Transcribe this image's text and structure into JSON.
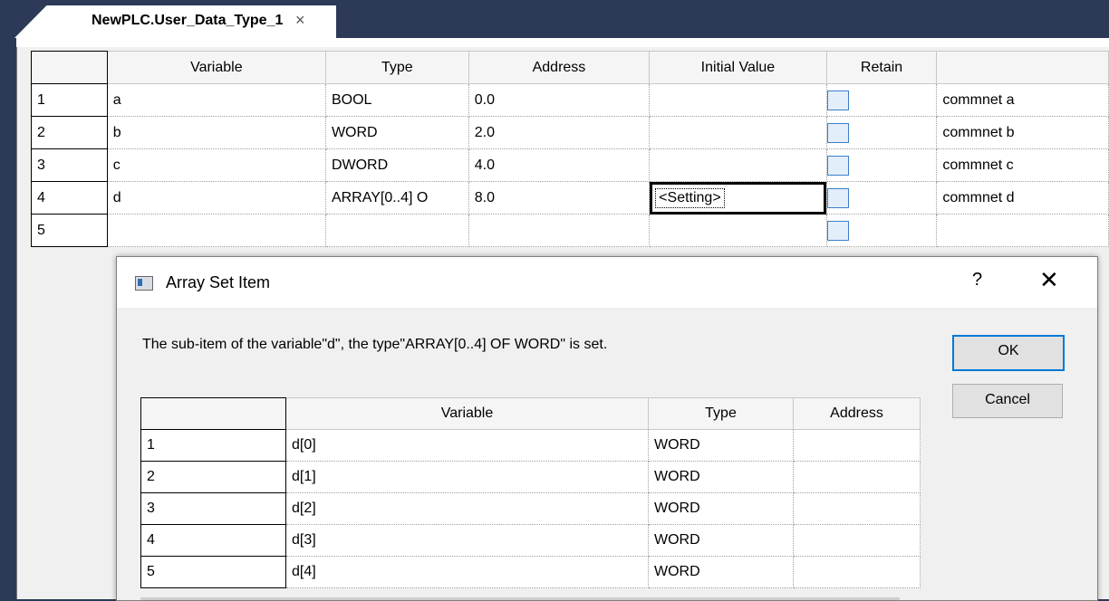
{
  "tab": {
    "title": "NewPLC.User_Data_Type_1",
    "close": "×"
  },
  "main_table": {
    "columns": [
      "",
      "Variable",
      "Type",
      "Address",
      "Initial Value",
      "Retain",
      ""
    ],
    "rows": [
      {
        "num": "1",
        "variable": "a",
        "type": "BOOL",
        "address": "0.0",
        "initial": "",
        "retain": false,
        "comment": "commnet a"
      },
      {
        "num": "2",
        "variable": "b",
        "type": "WORD",
        "address": "2.0",
        "initial": "",
        "retain": false,
        "comment": "commnet b"
      },
      {
        "num": "3",
        "variable": "c",
        "type": "DWORD",
        "address": "4.0",
        "initial": "",
        "retain": false,
        "comment": "commnet c"
      },
      {
        "num": "4",
        "variable": "d",
        "type": "ARRAY[0..4] O",
        "address": "8.0",
        "initial": "<Setting>",
        "retain": false,
        "comment": "commnet d"
      },
      {
        "num": "5",
        "variable": "",
        "type": "",
        "address": "",
        "initial": "",
        "retain": false,
        "comment": ""
      }
    ]
  },
  "dialog": {
    "title": "Array Set Item",
    "help": "?",
    "close": "✕",
    "message": "The sub-item of the variable\"d\", the type\"ARRAY[0..4] OF WORD\" is set.",
    "ok_label": "OK",
    "cancel_label": "Cancel",
    "columns": [
      "",
      "Variable",
      "Type",
      "Address"
    ],
    "rows": [
      {
        "num": "1",
        "variable": "d[0]",
        "type": "WORD",
        "address": ""
      },
      {
        "num": "2",
        "variable": "d[1]",
        "type": "WORD",
        "address": ""
      },
      {
        "num": "3",
        "variable": "d[2]",
        "type": "WORD",
        "address": ""
      },
      {
        "num": "4",
        "variable": "d[3]",
        "type": "WORD",
        "address": ""
      },
      {
        "num": "5",
        "variable": "d[4]",
        "type": "WORD",
        "address": ""
      }
    ]
  }
}
